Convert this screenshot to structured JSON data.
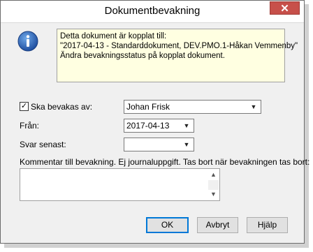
{
  "dialog": {
    "title": "Dokumentbevakning",
    "close_label": "✕"
  },
  "info": {
    "line1": "Detta dokument är kopplat till:",
    "line2": "\"2017-04-13 - Standarddokument, DEV.PMO.1-Håkan Vemmenby\"",
    "line3": "Ändra bevakningsstatus på kopplat dokument."
  },
  "form": {
    "watcher_checked": true,
    "watcher_label": "Ska bevakas av:",
    "watcher_value": "Johan Frisk",
    "from_label": "Från:",
    "from_value": "2017-04-13",
    "reply_label": "Svar senast:",
    "reply_value": "",
    "comment_label": "Kommentar till bevakning. Ej journaluppgift. Tas bort när bevakningen tas bort:",
    "comment_value": ""
  },
  "buttons": {
    "ok": "OK",
    "cancel": "Avbryt",
    "help": "Hjälp"
  },
  "icons": {
    "info": "info-icon",
    "dropdown": "chevron-down-icon"
  },
  "colors": {
    "info_bg": "#ffffe1",
    "close_bg": "#c7504a",
    "accent": "#0078d7"
  }
}
